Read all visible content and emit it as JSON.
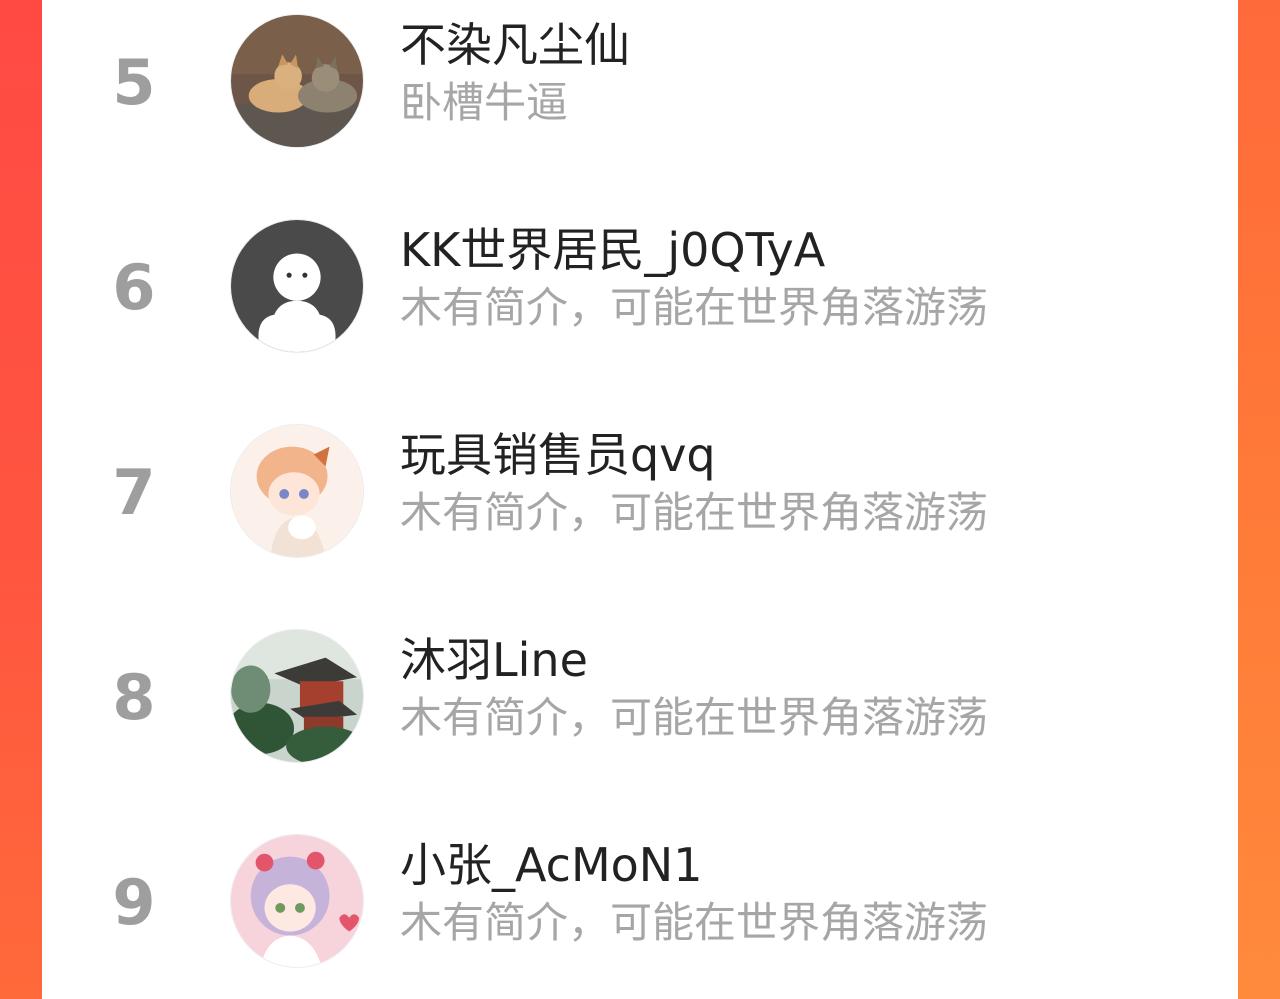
{
  "ranking_list": {
    "entries": [
      {
        "rank": "5",
        "name": "不染凡尘仙",
        "bio": "卧槽牛逼",
        "avatar": "cats-photo-avatar"
      },
      {
        "rank": "6",
        "name": "KK世界居民_j0QTyA",
        "bio": "木有简介，可能在世界角落游荡",
        "avatar": "default-ghost-avatar"
      },
      {
        "rank": "7",
        "name": "玩具销售员qvq",
        "bio": "木有简介，可能在世界角落游荡",
        "avatar": "anime-boy-avatar"
      },
      {
        "rank": "8",
        "name": "沐羽Line",
        "bio": "木有简介，可能在世界角落游荡",
        "avatar": "pavilion-painting-avatar"
      },
      {
        "rank": "9",
        "name": "小张_AcMoN1",
        "bio": "木有简介，可能在世界角落游荡",
        "avatar": "anime-girl-avatar"
      }
    ]
  },
  "colors": {
    "accent_left": "#ff4a44",
    "accent_right": "#ff7a38",
    "rank_text": "#9e9e9e",
    "name_text": "#222222",
    "bio_text": "#a6a6a6"
  }
}
